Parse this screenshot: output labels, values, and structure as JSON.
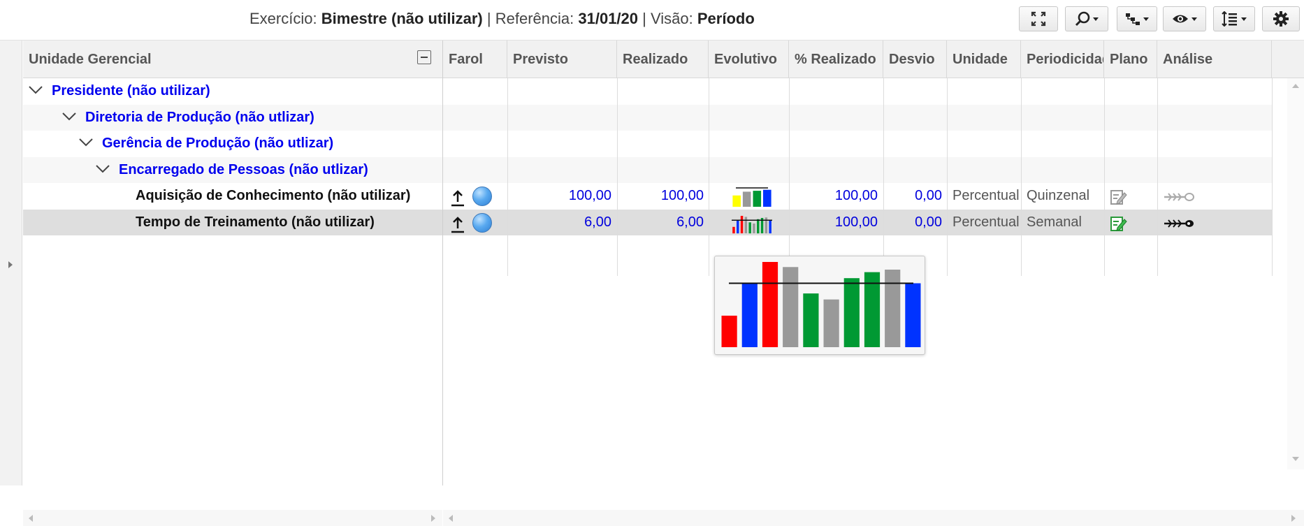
{
  "header": {
    "exercicio_label": "Exercício:",
    "exercicio_value": "Bimestre (não utilizar)",
    "sep1": "|",
    "referencia_label": "Referência:",
    "referencia_value": "31/01/20",
    "sep2": "|",
    "visao_label": "Visão:",
    "visao_value": "Período"
  },
  "toolbar": {
    "buttons": [
      "fullscreen-icon",
      "search-icon",
      "hierarchy-icon",
      "eye-icon",
      "sort-lines-icon",
      "gear-icon"
    ]
  },
  "columns": {
    "unidade_gerencial": "Unidade Gerencial",
    "farol": "Farol",
    "previsto": "Previsto",
    "realizado": "Realizado",
    "evolutivo": "Evolutivo",
    "pct_realizado": "% Realizado",
    "desvio": "Desvio",
    "unidade": "Unidade",
    "periodicidade": "Periodicidade",
    "plano": "Plano",
    "analise": "Análise"
  },
  "tree": {
    "level0": "Presidente (não utilizar)",
    "level1": "Diretoria de Produção (não utlizar)",
    "level2": "Gerência de Produção (não utlizar)",
    "level3": "Encarregado de Pessoas (não utlizar)"
  },
  "indicators": [
    {
      "name": "Aquisição de Conhecimento (não utilizar)",
      "farol_icon": "up-arrow-icon",
      "farol_color": "#4a9be8",
      "previsto": "100,00",
      "realizado": "100,00",
      "pct_realizado": "100,00",
      "desvio": "0,00",
      "unidade": "Percentual",
      "periodicidade": "Quinzenal",
      "plano_icon": "edit-plan-icon",
      "analise_icon": "fishbone-icon"
    },
    {
      "name": "Tempo de Treinamento (não utilizar)",
      "farol_icon": "up-arrow-icon",
      "farol_color": "#4a9be8",
      "previsto": "6,00",
      "realizado": "6,00",
      "pct_realizado": "100,00",
      "desvio": "0,00",
      "unidade": "Percentual",
      "periodicidade": "Semanal",
      "plano_icon": "edit-plan-icon",
      "analise_icon": "fishbone-icon"
    }
  ],
  "chart_data": [
    {
      "type": "bar",
      "colors": [
        "#ffff00",
        "#999999",
        "#009933",
        "#0033ff"
      ],
      "values": [
        0.6,
        0.8,
        0.85,
        0.9
      ],
      "target": 1.0,
      "ylim": [
        0,
        1
      ]
    },
    {
      "type": "bar",
      "colors": [
        "#ff0000",
        "#0033ff",
        "#ff0000",
        "#999999",
        "#009933",
        "#999999",
        "#009933",
        "#009933",
        "#999999",
        "#0033ff"
      ],
      "values": [
        0.37,
        0.75,
        1.0,
        0.94,
        0.63,
        0.56,
        0.81,
        0.88,
        0.91,
        0.75
      ],
      "target": 0.75,
      "ylim": [
        0,
        1
      ]
    }
  ],
  "colors": {
    "link_blue": "#0000ee",
    "number_blue": "#0000dd",
    "selected_row": "#dedede"
  }
}
